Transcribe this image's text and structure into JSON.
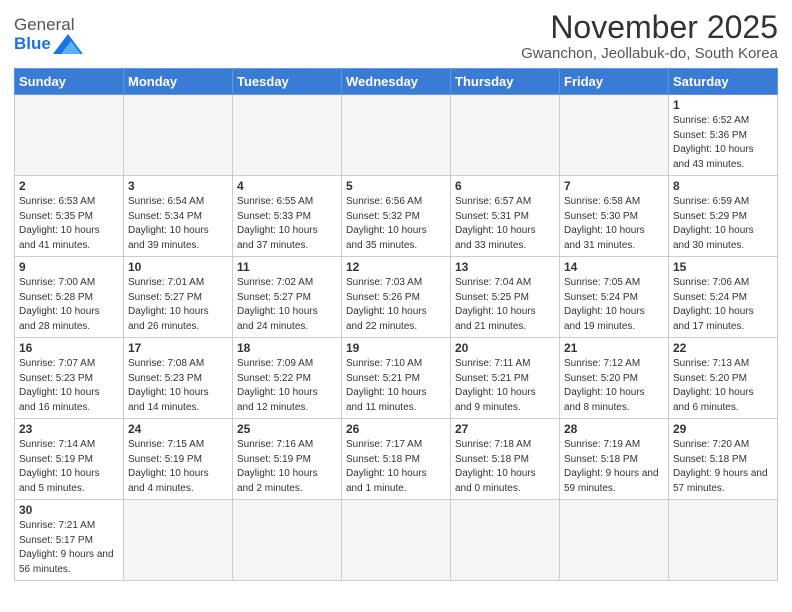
{
  "header": {
    "logo_general": "General",
    "logo_blue": "Blue",
    "month_title": "November 2025",
    "location": "Gwanchon, Jeollabuk-do, South Korea"
  },
  "weekdays": [
    "Sunday",
    "Monday",
    "Tuesday",
    "Wednesday",
    "Thursday",
    "Friday",
    "Saturday"
  ],
  "weeks": [
    [
      {
        "day": "",
        "empty": true
      },
      {
        "day": "",
        "empty": true
      },
      {
        "day": "",
        "empty": true
      },
      {
        "day": "",
        "empty": true
      },
      {
        "day": "",
        "empty": true
      },
      {
        "day": "",
        "empty": true
      },
      {
        "day": "1",
        "sunrise": "6:52 AM",
        "sunset": "5:36 PM",
        "daylight": "10 hours and 43 minutes."
      }
    ],
    [
      {
        "day": "2",
        "sunrise": "6:53 AM",
        "sunset": "5:35 PM",
        "daylight": "10 hours and 41 minutes."
      },
      {
        "day": "3",
        "sunrise": "6:54 AM",
        "sunset": "5:34 PM",
        "daylight": "10 hours and 39 minutes."
      },
      {
        "day": "4",
        "sunrise": "6:55 AM",
        "sunset": "5:33 PM",
        "daylight": "10 hours and 37 minutes."
      },
      {
        "day": "5",
        "sunrise": "6:56 AM",
        "sunset": "5:32 PM",
        "daylight": "10 hours and 35 minutes."
      },
      {
        "day": "6",
        "sunrise": "6:57 AM",
        "sunset": "5:31 PM",
        "daylight": "10 hours and 33 minutes."
      },
      {
        "day": "7",
        "sunrise": "6:58 AM",
        "sunset": "5:30 PM",
        "daylight": "10 hours and 31 minutes."
      },
      {
        "day": "8",
        "sunrise": "6:59 AM",
        "sunset": "5:29 PM",
        "daylight": "10 hours and 30 minutes."
      }
    ],
    [
      {
        "day": "9",
        "sunrise": "7:00 AM",
        "sunset": "5:28 PM",
        "daylight": "10 hours and 28 minutes."
      },
      {
        "day": "10",
        "sunrise": "7:01 AM",
        "sunset": "5:27 PM",
        "daylight": "10 hours and 26 minutes."
      },
      {
        "day": "11",
        "sunrise": "7:02 AM",
        "sunset": "5:27 PM",
        "daylight": "10 hours and 24 minutes."
      },
      {
        "day": "12",
        "sunrise": "7:03 AM",
        "sunset": "5:26 PM",
        "daylight": "10 hours and 22 minutes."
      },
      {
        "day": "13",
        "sunrise": "7:04 AM",
        "sunset": "5:25 PM",
        "daylight": "10 hours and 21 minutes."
      },
      {
        "day": "14",
        "sunrise": "7:05 AM",
        "sunset": "5:24 PM",
        "daylight": "10 hours and 19 minutes."
      },
      {
        "day": "15",
        "sunrise": "7:06 AM",
        "sunset": "5:24 PM",
        "daylight": "10 hours and 17 minutes."
      }
    ],
    [
      {
        "day": "16",
        "sunrise": "7:07 AM",
        "sunset": "5:23 PM",
        "daylight": "10 hours and 16 minutes."
      },
      {
        "day": "17",
        "sunrise": "7:08 AM",
        "sunset": "5:23 PM",
        "daylight": "10 hours and 14 minutes."
      },
      {
        "day": "18",
        "sunrise": "7:09 AM",
        "sunset": "5:22 PM",
        "daylight": "10 hours and 12 minutes."
      },
      {
        "day": "19",
        "sunrise": "7:10 AM",
        "sunset": "5:21 PM",
        "daylight": "10 hours and 11 minutes."
      },
      {
        "day": "20",
        "sunrise": "7:11 AM",
        "sunset": "5:21 PM",
        "daylight": "10 hours and 9 minutes."
      },
      {
        "day": "21",
        "sunrise": "7:12 AM",
        "sunset": "5:20 PM",
        "daylight": "10 hours and 8 minutes."
      },
      {
        "day": "22",
        "sunrise": "7:13 AM",
        "sunset": "5:20 PM",
        "daylight": "10 hours and 6 minutes."
      }
    ],
    [
      {
        "day": "23",
        "sunrise": "7:14 AM",
        "sunset": "5:19 PM",
        "daylight": "10 hours and 5 minutes."
      },
      {
        "day": "24",
        "sunrise": "7:15 AM",
        "sunset": "5:19 PM",
        "daylight": "10 hours and 4 minutes."
      },
      {
        "day": "25",
        "sunrise": "7:16 AM",
        "sunset": "5:19 PM",
        "daylight": "10 hours and 2 minutes."
      },
      {
        "day": "26",
        "sunrise": "7:17 AM",
        "sunset": "5:18 PM",
        "daylight": "10 hours and 1 minute."
      },
      {
        "day": "27",
        "sunrise": "7:18 AM",
        "sunset": "5:18 PM",
        "daylight": "10 hours and 0 minutes."
      },
      {
        "day": "28",
        "sunrise": "7:19 AM",
        "sunset": "5:18 PM",
        "daylight": "9 hours and 59 minutes."
      },
      {
        "day": "29",
        "sunrise": "7:20 AM",
        "sunset": "5:18 PM",
        "daylight": "9 hours and 57 minutes."
      }
    ],
    [
      {
        "day": "30",
        "sunrise": "7:21 AM",
        "sunset": "5:17 PM",
        "daylight": "9 hours and 56 minutes.",
        "lastrow": true
      },
      {
        "day": "",
        "empty": true,
        "lastrow": true
      },
      {
        "day": "",
        "empty": true,
        "lastrow": true
      },
      {
        "day": "",
        "empty": true,
        "lastrow": true
      },
      {
        "day": "",
        "empty": true,
        "lastrow": true
      },
      {
        "day": "",
        "empty": true,
        "lastrow": true
      },
      {
        "day": "",
        "empty": true,
        "lastrow": true
      }
    ]
  ]
}
